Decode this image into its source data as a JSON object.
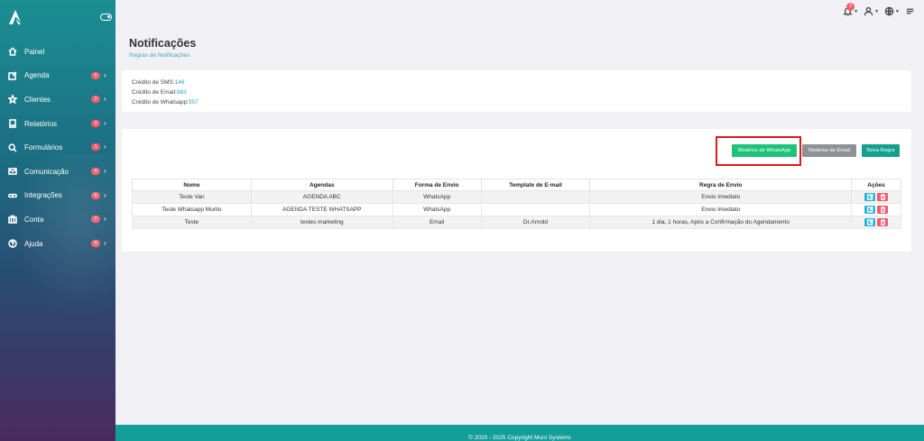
{
  "sidebar": {
    "items": [
      {
        "label": "Painel",
        "icon": "home-icon",
        "badge": null
      },
      {
        "label": "Agenda",
        "icon": "edit-icon",
        "badge": "9"
      },
      {
        "label": "Clientes",
        "icon": "star-icon",
        "badge": "2"
      },
      {
        "label": "Relatórios",
        "icon": "book-icon",
        "badge": "3"
      },
      {
        "label": "Formulários",
        "icon": "search-icon",
        "badge": "1"
      },
      {
        "label": "Comunicação",
        "icon": "mail-icon",
        "badge": "4"
      },
      {
        "label": "Integrações",
        "icon": "link-icon",
        "badge": "6"
      },
      {
        "label": "Conta",
        "icon": "briefcase-icon",
        "badge": "7"
      },
      {
        "label": "Ajuda",
        "icon": "help-icon",
        "badge": "4"
      }
    ]
  },
  "topbar": {
    "notification_count": "3"
  },
  "page": {
    "title": "Notificações",
    "subtitle": "Regras de Notificações"
  },
  "credits": [
    {
      "label": "Crédito de SMS:",
      "value": "146"
    },
    {
      "label": "Crédito de Email:",
      "value": "983"
    },
    {
      "label": "Crédito de Whatsapp:",
      "value": "557"
    }
  ],
  "buttons": {
    "whatsapp_models": "Modelos de WhatsApp",
    "email_models": "Modelos de Email",
    "new_rule": "Nova Regra"
  },
  "table": {
    "headers": [
      "Nome",
      "Agendas",
      "Forma de Envio",
      "Template de E-mail",
      "Regra de Envio",
      "Ações"
    ],
    "rows": [
      [
        "Teste Van",
        "AGENDA ABC",
        "WhatsApp",
        "",
        "Envio Imediato"
      ],
      [
        "Teste Whatsapp Murilo",
        "AGENDA TESTE WHATSAPP",
        "WhatsApp",
        "",
        "Envio Imediato"
      ],
      [
        "Teste",
        "testes marketing",
        "Email",
        "Dr.Arnold",
        "1 dia, 1 horas, Após a Confirmação do Agendamento"
      ]
    ]
  },
  "footer": {
    "text": "© 2020 - 2025 Copyright Muni Systems"
  },
  "colors": {
    "accent": "#149e9a",
    "badge": "#f05d6c",
    "whatsapp_button": "#1ec27a",
    "highlight": "#e01919"
  }
}
